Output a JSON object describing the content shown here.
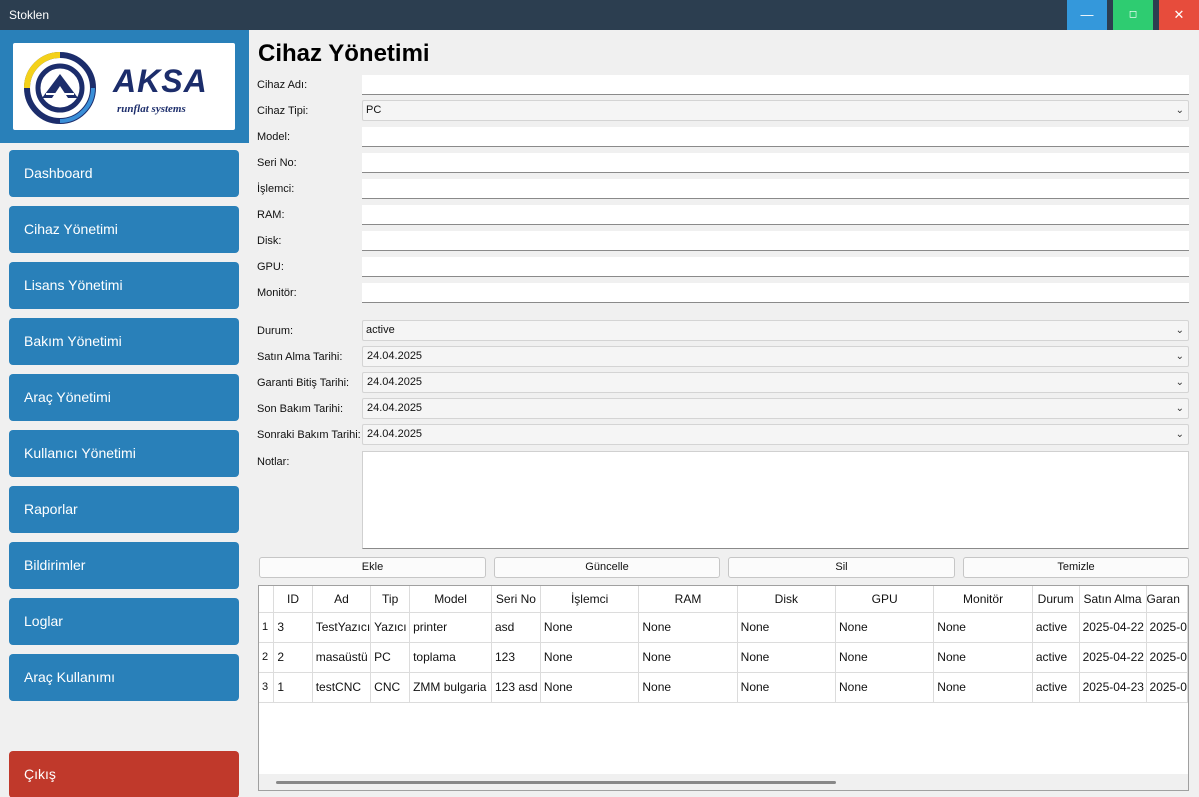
{
  "window": {
    "title": "Stoklen",
    "min_glyph": "—",
    "max_glyph": "◻",
    "close_glyph": "✕"
  },
  "logo": {
    "name": "AKSA",
    "tagline": "runflat systems"
  },
  "sidebar": {
    "items": [
      {
        "label": "Dashboard"
      },
      {
        "label": "Cihaz Yönetimi"
      },
      {
        "label": "Lisans Yönetimi"
      },
      {
        "label": "Bakım Yönetimi"
      },
      {
        "label": "Araç Yönetimi"
      },
      {
        "label": "Kullanıcı Yönetimi"
      },
      {
        "label": "Raporlar"
      },
      {
        "label": "Bildirimler"
      },
      {
        "label": "Loglar"
      },
      {
        "label": "Araç Kullanımı"
      }
    ],
    "exit_label": "Çıkış"
  },
  "page": {
    "title": "Cihaz Yönetimi"
  },
  "form": {
    "cihaz_adi": {
      "label": "Cihaz Adı:",
      "value": ""
    },
    "cihaz_tipi": {
      "label": "Cihaz Tipi:",
      "value": "PC"
    },
    "model": {
      "label": "Model:",
      "value": ""
    },
    "seri_no": {
      "label": "Seri No:",
      "value": ""
    },
    "islemci": {
      "label": "İşlemci:",
      "value": ""
    },
    "ram": {
      "label": "RAM:",
      "value": ""
    },
    "disk": {
      "label": "Disk:",
      "value": ""
    },
    "gpu": {
      "label": "GPU:",
      "value": ""
    },
    "monitor": {
      "label": "Monitör:",
      "value": ""
    },
    "durum": {
      "label": "Durum:",
      "value": "active"
    },
    "satin_alma": {
      "label": "Satın Alma Tarihi:",
      "value": "24.04.2025"
    },
    "garanti": {
      "label": "Garanti Bitiş Tarihi:",
      "value": "24.04.2025"
    },
    "son_bakim": {
      "label": "Son Bakım Tarihi:",
      "value": "24.04.2025"
    },
    "sonraki_bakim": {
      "label": "Sonraki Bakım Tarihi:",
      "value": "24.04.2025"
    },
    "notlar": {
      "label": "Notlar:",
      "value": ""
    }
  },
  "actions": {
    "add": "Ekle",
    "update": "Güncelle",
    "delete": "Sil",
    "clear": "Temizle"
  },
  "table": {
    "columns": [
      "ID",
      "Ad",
      "Tip",
      "Model",
      "Seri No",
      "İşlemci",
      "RAM",
      "Disk",
      "GPU",
      "Monitör",
      "Durum",
      "Satın Alma",
      "Garan"
    ],
    "rows": [
      {
        "n": "1",
        "cells": [
          "3",
          "TestYazıcı",
          "Yazıcı",
          "printer",
          "asd",
          "None",
          "None",
          "None",
          "None",
          "None",
          "active",
          "2025-04-22",
          "2025-0"
        ]
      },
      {
        "n": "2",
        "cells": [
          "2",
          "masaüstü",
          "PC",
          "toplama",
          "123",
          "None",
          "None",
          "None",
          "None",
          "None",
          "active",
          "2025-04-22",
          "2025-0"
        ]
      },
      {
        "n": "3",
        "cells": [
          "1",
          "testCNC",
          "CNC",
          "ZMM bulgaria",
          "123 asd",
          "None",
          "None",
          "None",
          "None",
          "None",
          "active",
          "2025-04-23",
          "2025-0"
        ]
      }
    ]
  },
  "icons": {
    "chevron": "chevron-down-icon"
  },
  "colors": {
    "sidebar_button": "#2980b9",
    "exit_button": "#c0392b",
    "titlebar": "#2c3e50"
  }
}
